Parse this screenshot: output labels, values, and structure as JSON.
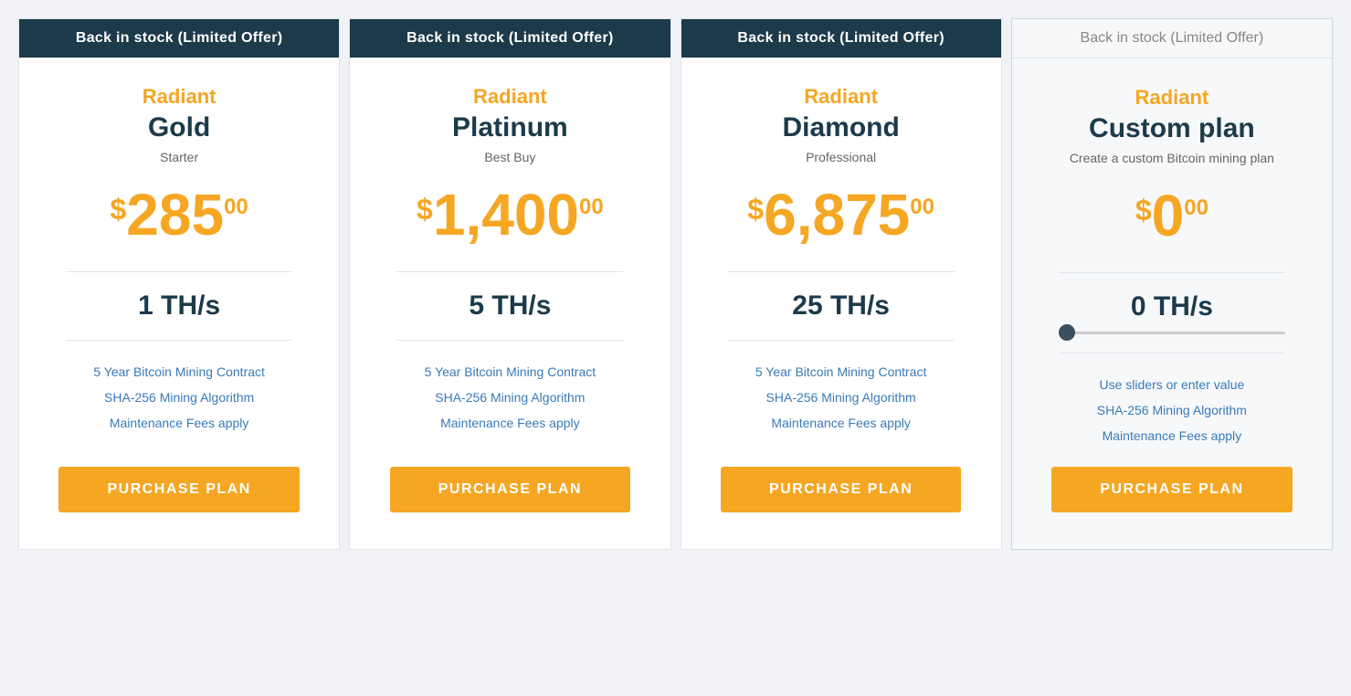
{
  "cards": [
    {
      "id": "gold",
      "banner": "Back in stock (Limited Offer)",
      "bannerStyle": "filled",
      "brand": "Radiant",
      "plan": "Gold",
      "subtitle": "Starter",
      "price_symbol": "$",
      "price_main": "285",
      "price_cents": "00",
      "hashrate": "1 TH/s",
      "features": [
        "5 Year Bitcoin Mining Contract",
        "SHA-256 Mining Algorithm",
        "Maintenance Fees apply"
      ],
      "button_label": "PURCHASE PLAN"
    },
    {
      "id": "platinum",
      "banner": "Back in stock (Limited Offer)",
      "bannerStyle": "filled",
      "brand": "Radiant",
      "plan": "Platinum",
      "subtitle": "Best Buy",
      "price_symbol": "$",
      "price_main": "1,400",
      "price_cents": "00",
      "hashrate": "5 TH/s",
      "features": [
        "5 Year Bitcoin Mining Contract",
        "SHA-256 Mining Algorithm",
        "Maintenance Fees apply"
      ],
      "button_label": "PURCHASE PLAN"
    },
    {
      "id": "diamond",
      "banner": "Back in stock (Limited Offer)",
      "bannerStyle": "filled",
      "brand": "Radiant",
      "plan": "Diamond",
      "subtitle": "Professional",
      "price_symbol": "$",
      "price_main": "6,875",
      "price_cents": "00",
      "hashrate": "25 TH/s",
      "features": [
        "5 Year Bitcoin Mining Contract",
        "SHA-256 Mining Algorithm",
        "Maintenance Fees apply"
      ],
      "button_label": "PURCHASE PLAN"
    },
    {
      "id": "custom",
      "banner": "Back in stock (Limited Offer)",
      "bannerStyle": "plain",
      "brand": "Radiant",
      "plan": "Custom plan",
      "subtitle": "Create a custom Bitcoin mining plan",
      "price_symbol": "$",
      "price_main": "0",
      "price_cents": "00",
      "hashrate": "0 TH/s",
      "hasSlider": true,
      "features": [
        "Use sliders or enter value",
        "SHA-256 Mining Algorithm",
        "Maintenance Fees apply"
      ],
      "button_label": "PURCHASE PLAN"
    }
  ]
}
